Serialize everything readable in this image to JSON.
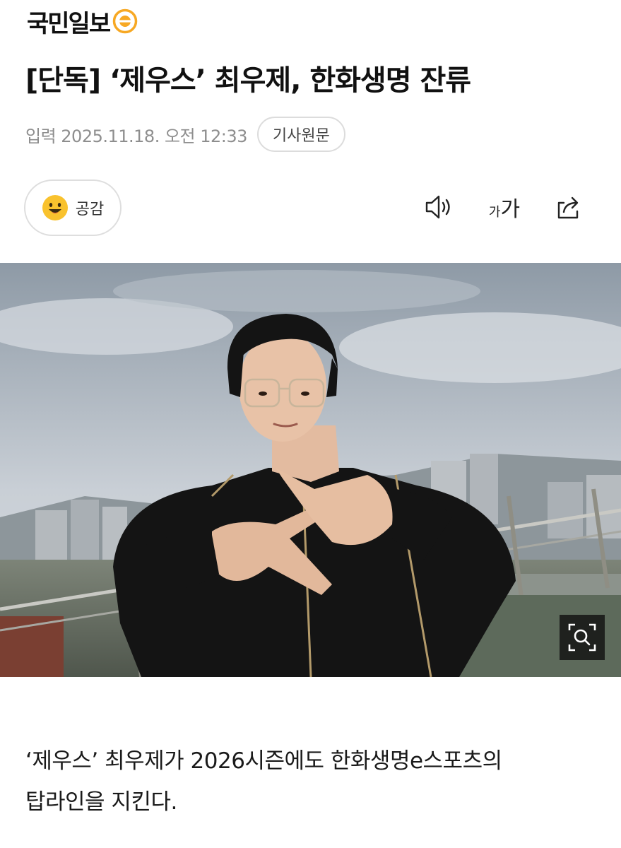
{
  "brand": {
    "name": "국민일보",
    "logo_mark": "kukmin-circle-mark",
    "accent": "#f7a823"
  },
  "article": {
    "headline": "[단독] ‘제우스’ 최우제, 한화생명 잔류",
    "date_label": "입력 2025.11.18. 오전 12:33",
    "original_link_label": "기사원문",
    "body_lines": [
      "‘제우스’ 최우제가 2026시즌에도 한화생명e스포츠의",
      "탑라인을 지킨다."
    ]
  },
  "toolbar": {
    "reaction_label": "공감",
    "reaction_icon": "smile-emoji-icon",
    "listen_icon": "speaker-icon",
    "font_size_small": "가",
    "font_size_large": "가",
    "share_icon": "share-icon"
  },
  "photo": {
    "zoom_icon": "magnifier-zoom-icon"
  }
}
